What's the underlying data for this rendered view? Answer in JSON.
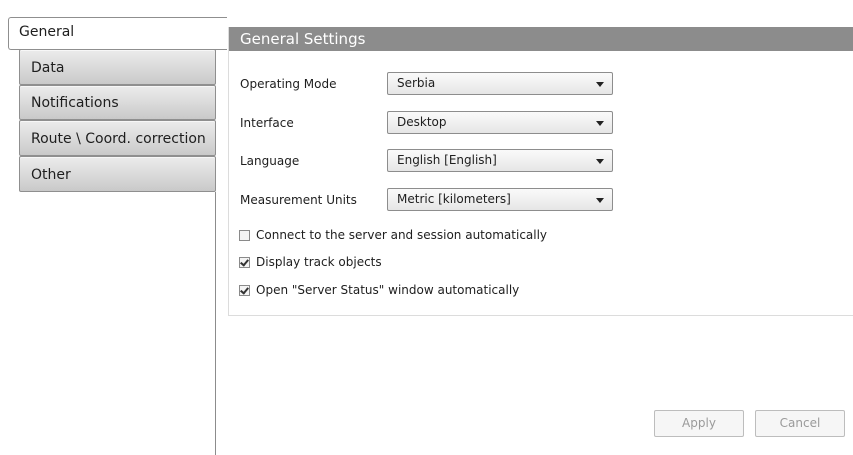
{
  "tabs": [
    {
      "label": "General",
      "active": true
    },
    {
      "label": "Data",
      "active": false
    },
    {
      "label": "Notifications",
      "active": false
    },
    {
      "label": "Route \\ Coord. correction",
      "active": false
    },
    {
      "label": "Other",
      "active": false
    }
  ],
  "panel": {
    "title": "General Settings",
    "fields": [
      {
        "label": "Operating Mode",
        "value": "Serbia"
      },
      {
        "label": "Interface",
        "value": "Desktop"
      },
      {
        "label": "Language",
        "value": "English [English]"
      },
      {
        "label": "Measurement Units",
        "value": "Metric [kilometers]"
      }
    ],
    "checkboxes": [
      {
        "label": "Connect to the server and session automatically",
        "checked": false
      },
      {
        "label": "Display track objects",
        "checked": true
      },
      {
        "label": "Open \"Server Status\" window automatically",
        "checked": true
      }
    ]
  },
  "buttons": {
    "apply": "Apply",
    "cancel": "Cancel",
    "enabled": false
  },
  "colors": {
    "header_bg": "#8c8c8c",
    "tab_gradient_top": "#ececec",
    "tab_gradient_bottom": "#c9c9c9"
  }
}
